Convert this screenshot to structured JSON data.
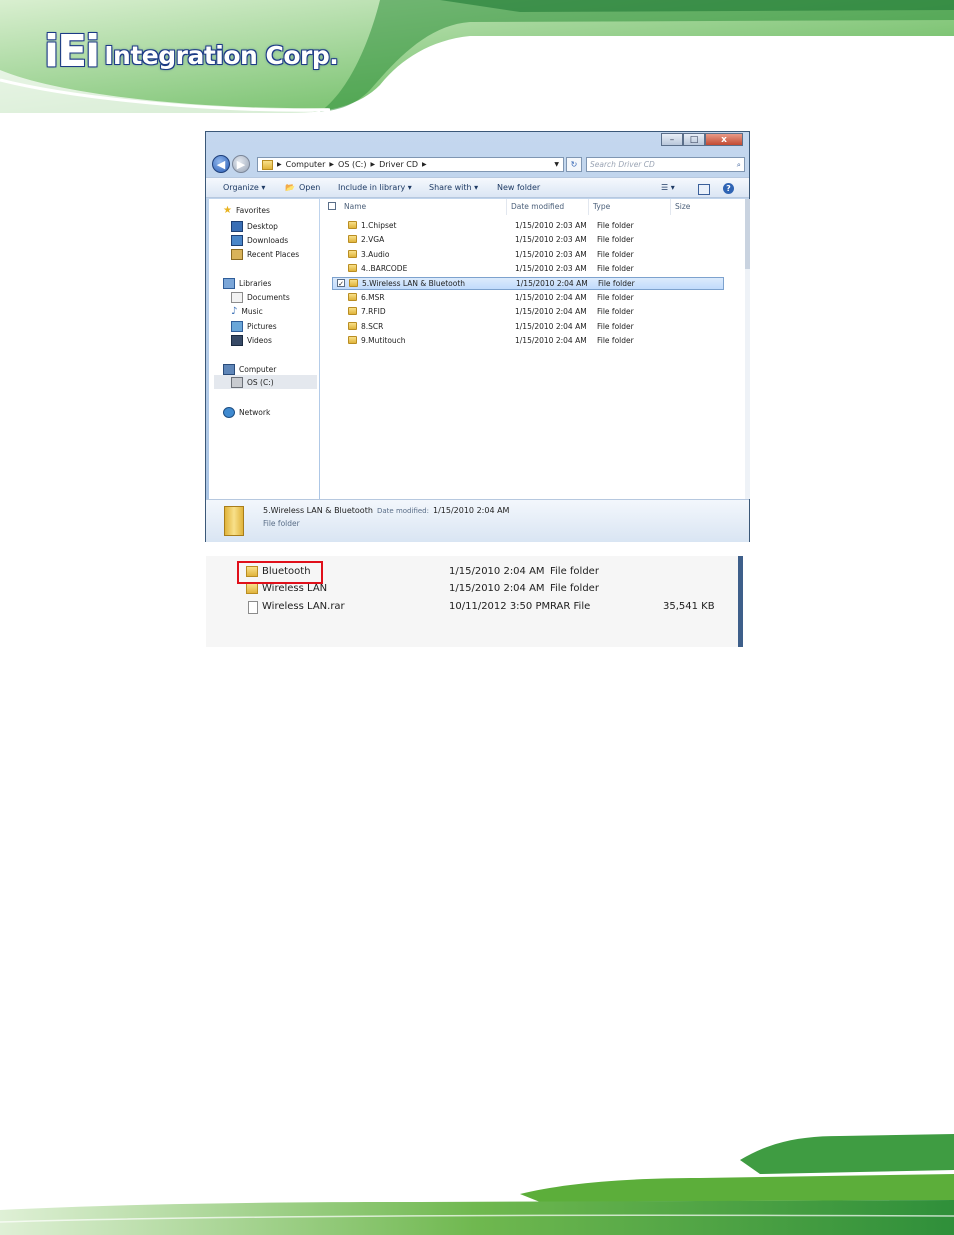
{
  "brand": {
    "logo_mark": "iEi",
    "logo_text": "Integration Corp."
  },
  "window": {
    "caption_buttons": {
      "minimize": "–",
      "maximize": "□",
      "close": "x"
    },
    "address": {
      "crumbs": [
        "Computer",
        "OS (C:)",
        "Driver CD"
      ]
    },
    "search_placeholder": "Search Driver CD",
    "toolbar": {
      "organize": "Organize ▾",
      "open": "Open",
      "include": "Include in library ▾",
      "share": "Share with ▾",
      "new_folder": "New folder"
    },
    "nav": {
      "favorites": "Favorites",
      "desktop": "Desktop",
      "downloads": "Downloads",
      "recent": "Recent Places",
      "libraries": "Libraries",
      "documents": "Documents",
      "music": "Music",
      "pictures": "Pictures",
      "videos": "Videos",
      "computer": "Computer",
      "os": "OS (C:)",
      "network": "Network"
    },
    "columns": {
      "name": "Name",
      "date": "Date modified",
      "type": "Type",
      "size": "Size"
    },
    "rows": [
      {
        "name": "1.Chipset",
        "date": "1/15/2010 2:03 AM",
        "type": "File folder"
      },
      {
        "name": "2.VGA",
        "date": "1/15/2010 2:03 AM",
        "type": "File folder"
      },
      {
        "name": "3.Audio",
        "date": "1/15/2010 2:03 AM",
        "type": "File folder"
      },
      {
        "name": "4..BARCODE",
        "date": "1/15/2010 2:03 AM",
        "type": "File folder"
      },
      {
        "name": "5.Wireless LAN & Bluetooth",
        "date": "1/15/2010 2:04 AM",
        "type": "File folder"
      },
      {
        "name": "6.MSR",
        "date": "1/15/2010 2:04 AM",
        "type": "File folder"
      },
      {
        "name": "7.RFID",
        "date": "1/15/2010 2:04 AM",
        "type": "File folder"
      },
      {
        "name": "8.SCR",
        "date": "1/15/2010 2:04 AM",
        "type": "File folder"
      },
      {
        "name": "9.Mutitouch",
        "date": "1/15/2010 2:04 AM",
        "type": "File folder"
      }
    ],
    "details": {
      "name": "5.Wireless LAN & Bluetooth",
      "date_label": "Date modified:",
      "date": "1/15/2010 2:04 AM",
      "type": "File folder"
    }
  },
  "subfolder": {
    "rows": [
      {
        "name": "Bluetooth",
        "date": "1/15/2010 2:04 AM",
        "type": "File folder",
        "size": ""
      },
      {
        "name": "Wireless LAN",
        "date": "1/15/2010 2:04 AM",
        "type": "File folder",
        "size": ""
      },
      {
        "name": "Wireless LAN.rar",
        "date": "10/11/2012 3:50 PM",
        "type": "RAR File",
        "size": "35,541 KB"
      }
    ]
  },
  "colors": {
    "brand_blue": "#1c3a86",
    "brand_green": "#5cae3a",
    "highlight_red": "#e0101a",
    "selection": "#c1dbfc"
  }
}
